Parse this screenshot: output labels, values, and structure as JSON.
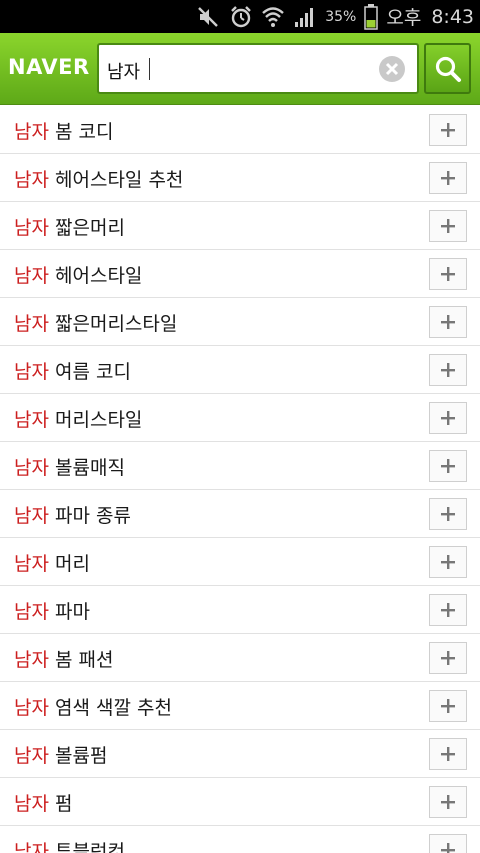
{
  "status_bar": {
    "battery_percent": "35%",
    "ampm": "오후",
    "time": "8:43",
    "icons": [
      "mute-icon",
      "alarm-icon",
      "wifi-icon",
      "signal-icon",
      "battery-icon"
    ]
  },
  "header": {
    "logo": "NAVER",
    "search_value": "남자",
    "clear_icon": "close-icon",
    "search_icon": "search-icon"
  },
  "colors": {
    "header_green": "#6cbd1f",
    "keyword_red": "#cc1f1f"
  },
  "suggestions": [
    {
      "keyword": "남자",
      "rest": " 봄 코디"
    },
    {
      "keyword": "남자",
      "rest": " 헤어스타일 추천"
    },
    {
      "keyword": "남자",
      "rest": " 짧은머리"
    },
    {
      "keyword": "남자",
      "rest": " 헤어스타일"
    },
    {
      "keyword": "남자",
      "rest": " 짧은머리스타일"
    },
    {
      "keyword": "남자",
      "rest": " 여름 코디"
    },
    {
      "keyword": "남자",
      "rest": " 머리스타일"
    },
    {
      "keyword": "남자",
      "rest": " 볼륨매직"
    },
    {
      "keyword": "남자",
      "rest": " 파마 종류"
    },
    {
      "keyword": "남자",
      "rest": " 머리"
    },
    {
      "keyword": "남자",
      "rest": " 파마"
    },
    {
      "keyword": "남자",
      "rest": " 봄 패션"
    },
    {
      "keyword": "남자",
      "rest": " 염색 색깔 추천"
    },
    {
      "keyword": "남자",
      "rest": " 볼륨펌"
    },
    {
      "keyword": "남자",
      "rest": " 펌"
    },
    {
      "keyword": "남자",
      "rest": " 투블럭컷"
    }
  ]
}
